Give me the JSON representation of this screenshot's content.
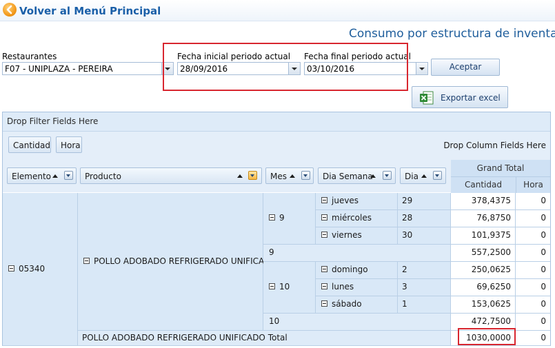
{
  "header": {
    "back_label": "Volver al Menú Principal",
    "page_title": "Consumo por estructura de inventar"
  },
  "filters": {
    "restaurant_label": "Restaurantes",
    "restaurant_value": "F07 - UNIPLAZA - PEREIRA",
    "start_label": "Fecha inicial periodo actual",
    "start_value": "28/09/2016",
    "end_label": "Fecha final periodo actual",
    "end_value": "03/10/2016",
    "accept_label": "Aceptar",
    "export_label": "Exportar excel"
  },
  "pivot": {
    "filter_area": "Drop Filter Fields Here",
    "data_fields": [
      "Cantidad",
      "Hora"
    ],
    "drop_column": "Drop Column Fields Here",
    "row_fields": [
      "Elemento",
      "Producto",
      "Mes",
      "Dia Semana",
      "Dia"
    ],
    "grand_total": "Grand Total",
    "value_headers": [
      "Cantidad",
      "Hora"
    ],
    "elemento": "05340",
    "producto": "POLLO ADOBADO REFRIGERADO UNIFICADO",
    "months": [
      {
        "mes": "9",
        "rows": [
          {
            "dia_semana": "jueves",
            "dia": "29",
            "cantidad": "378,4375",
            "hora": "0"
          },
          {
            "dia_semana": "miércoles",
            "dia": "28",
            "cantidad": "76,8750",
            "hora": "0"
          },
          {
            "dia_semana": "viernes",
            "dia": "30",
            "cantidad": "101,9375",
            "hora": "0"
          }
        ],
        "total_label": "9",
        "total_cantidad": "557,2500",
        "total_hora": "0"
      },
      {
        "mes": "10",
        "rows": [
          {
            "dia_semana": "domingo",
            "dia": "2",
            "cantidad": "250,0625",
            "hora": "0"
          },
          {
            "dia_semana": "lunes",
            "dia": "3",
            "cantidad": "69,6250",
            "hora": "0"
          },
          {
            "dia_semana": "sábado",
            "dia": "1",
            "cantidad": "153,0625",
            "hora": "0"
          }
        ],
        "total_label": "10",
        "total_cantidad": "472,7500",
        "total_hora": "0"
      }
    ],
    "product_total_label": "POLLO ADOBADO REFRIGERADO UNIFICADO Total",
    "product_total_cantidad": "1030,0000",
    "product_total_hora": "0"
  },
  "colors": {
    "highlight": "#d8262f",
    "title_blue": "#1f5e9c",
    "header_bg": "#d9e8f7"
  }
}
